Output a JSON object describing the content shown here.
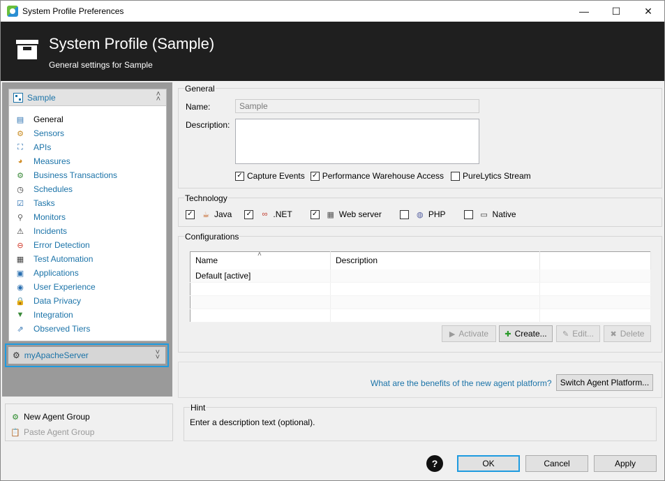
{
  "window": {
    "title": "System Profile Preferences",
    "controls": {
      "minimize": "—",
      "maximize": "☐",
      "close": "✕"
    }
  },
  "header": {
    "title": "System Profile (Sample)",
    "subtitle": "General settings for Sample"
  },
  "sidebar": {
    "profile_name": "Sample",
    "items": [
      {
        "label": "General",
        "icon": "general-icon"
      },
      {
        "label": "Sensors",
        "icon": "sensors-icon"
      },
      {
        "label": "APIs",
        "icon": "apis-icon"
      },
      {
        "label": "Measures",
        "icon": "measures-icon"
      },
      {
        "label": "Business Transactions",
        "icon": "business-transactions-icon"
      },
      {
        "label": "Schedules",
        "icon": "clock-icon"
      },
      {
        "label": "Tasks",
        "icon": "tasks-icon"
      },
      {
        "label": "Monitors",
        "icon": "magnifier-icon"
      },
      {
        "label": "Incidents",
        "icon": "warning-icon"
      },
      {
        "label": "Error Detection",
        "icon": "error-icon"
      },
      {
        "label": "Test Automation",
        "icon": "test-automation-icon"
      },
      {
        "label": "Applications",
        "icon": "applications-icon"
      },
      {
        "label": "User Experience",
        "icon": "user-experience-icon"
      },
      {
        "label": "Data Privacy",
        "icon": "lock-icon"
      },
      {
        "label": "Integration",
        "icon": "integration-icon"
      },
      {
        "label": "Observed Tiers",
        "icon": "observed-tiers-icon"
      }
    ],
    "active_item": "General",
    "agent_group": "myApacheServer",
    "new_agent_group": "New Agent Group",
    "paste_agent_group": "Paste Agent Group"
  },
  "general": {
    "title": "General",
    "name_label": "Name:",
    "name_value": "Sample",
    "description_label": "Description:",
    "description_value": "",
    "checkboxes": [
      {
        "label": "Capture Events",
        "checked": true
      },
      {
        "label": "Performance Warehouse Access",
        "checked": true
      },
      {
        "label": "PureLytics Stream",
        "checked": false
      }
    ]
  },
  "technology": {
    "title": "Technology",
    "items": [
      {
        "label": "Java",
        "checked": true,
        "icon": "java-icon"
      },
      {
        "label": ".NET",
        "checked": true,
        "icon": "dotnet-icon"
      },
      {
        "label": "Web server",
        "checked": true,
        "icon": "web-server-icon"
      },
      {
        "label": "PHP",
        "checked": false,
        "icon": "php-icon"
      },
      {
        "label": "Native",
        "checked": false,
        "icon": "native-icon"
      }
    ]
  },
  "configurations": {
    "title": "Configurations",
    "columns": [
      "Name",
      "Description"
    ],
    "rows": [
      {
        "name": "Default  [active]",
        "description": ""
      }
    ],
    "buttons": {
      "activate": "Activate",
      "create": "Create...",
      "edit": "Edit...",
      "delete": "Delete"
    }
  },
  "agent_platform": {
    "link": "What are the benefits of the new agent platform?",
    "button": "Switch Agent Platform..."
  },
  "hint": {
    "title": "Hint",
    "text": "Enter a description text (optional)."
  },
  "footer": {
    "ok": "OK",
    "cancel": "Cancel",
    "apply": "Apply"
  },
  "colors": {
    "header_bg": "#1f1f1f",
    "link": "#1b73a8",
    "focus": "#1e9be0"
  }
}
